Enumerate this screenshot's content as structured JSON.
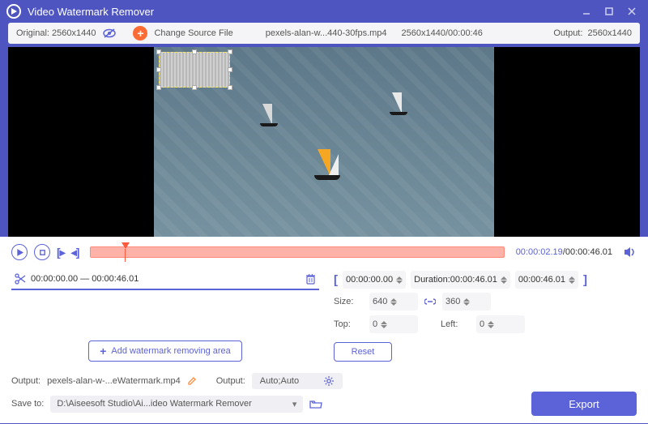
{
  "title": "Video Watermark Remover",
  "infobar": {
    "original_label": "Original:",
    "original_size": "2560x1440",
    "change_source": "Change Source File",
    "filename": "pexels-alan-w...440-30fps.mp4",
    "resolution_time": "2560x1440/00:00:46",
    "output_label": "Output:",
    "output_size": "2560x1440"
  },
  "timeline": {
    "current": "00:00:02.19",
    "total": "00:00:46.01"
  },
  "segment": {
    "range": "00:00:00.00 — 00:00:46.01"
  },
  "add_area": "Add watermark removing area",
  "trim": {
    "start": "00:00:00.00",
    "duration_label": "Duration:",
    "duration": "00:00:46.01",
    "end": "00:00:46.01"
  },
  "size": {
    "label": "Size:",
    "w": "640",
    "h": "360"
  },
  "pos": {
    "top_label": "Top:",
    "top": "0",
    "left_label": "Left:",
    "left": "0"
  },
  "reset": "Reset",
  "footer": {
    "output_label": "Output:",
    "output_file": "pexels-alan-w-...eWatermark.mp4",
    "output2_label": "Output:",
    "output_fmt": "Auto;Auto",
    "save_label": "Save to:",
    "save_path": "D:\\Aiseesoft Studio\\Ai...ideo Watermark Remover",
    "export": "Export"
  }
}
